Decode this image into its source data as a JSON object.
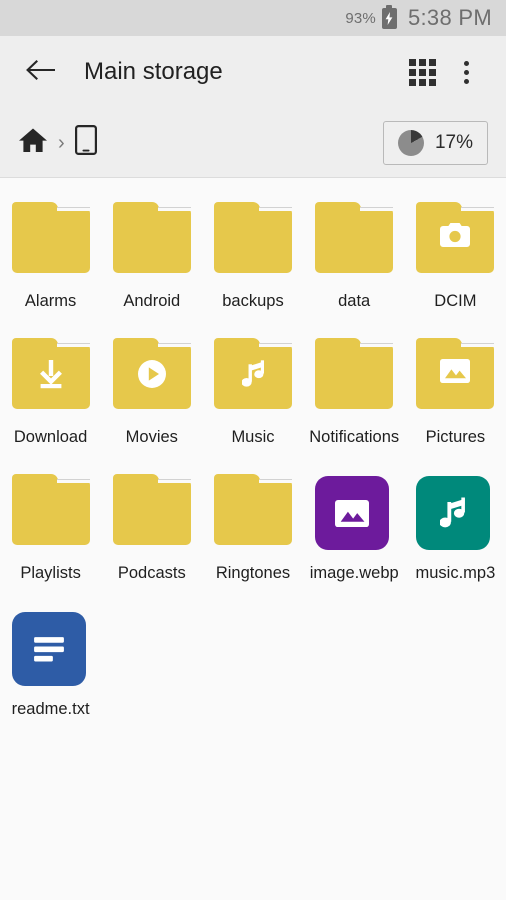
{
  "status_bar": {
    "battery_percent": "93%",
    "battery_icon": "battery-charging-icon",
    "time": "5:38 PM"
  },
  "app_bar": {
    "back_icon": "arrow-back-icon",
    "title": "Main storage",
    "view_toggle_icon": "grid-view-icon",
    "overflow_icon": "overflow-menu-icon"
  },
  "breadcrumb": {
    "items": [
      {
        "icon": "home-icon",
        "label": ""
      },
      {
        "icon": "phone-icon",
        "label": ""
      }
    ],
    "separator": "›",
    "storage": {
      "icon": "pie-chart-icon",
      "used_percent": "17%",
      "used_fraction": 0.17
    }
  },
  "files": [
    {
      "name": "Alarms",
      "type": "folder",
      "badge": "none"
    },
    {
      "name": "Android",
      "type": "folder",
      "badge": "none"
    },
    {
      "name": "backups",
      "type": "folder",
      "badge": "none"
    },
    {
      "name": "data",
      "type": "folder",
      "badge": "none"
    },
    {
      "name": "DCIM",
      "type": "folder",
      "badge": "camera-icon"
    },
    {
      "name": "Download",
      "type": "folder",
      "badge": "download-icon"
    },
    {
      "name": "Movies",
      "type": "folder",
      "badge": "play-circle-icon"
    },
    {
      "name": "Music",
      "type": "folder",
      "badge": "music-note-icon"
    },
    {
      "name": "Notifications",
      "type": "folder",
      "badge": "none"
    },
    {
      "name": "Pictures",
      "type": "folder",
      "badge": "image-icon"
    },
    {
      "name": "Playlists",
      "type": "folder",
      "badge": "none"
    },
    {
      "name": "Podcasts",
      "type": "folder",
      "badge": "none"
    },
    {
      "name": "Ringtones",
      "type": "folder",
      "badge": "none"
    },
    {
      "name": "image.webp",
      "type": "file",
      "badge": "image-icon",
      "tile_color": "#6D1B9C"
    },
    {
      "name": "music.mp3",
      "type": "file",
      "badge": "music-note-icon",
      "tile_color": "#00897B"
    },
    {
      "name": "readme.txt",
      "type": "file",
      "badge": "text-lines-icon",
      "tile_color": "#2E5CA6"
    }
  ],
  "colors": {
    "folder": "#E6C84B",
    "status_bar_bg": "#D8D8D8",
    "app_bar_bg": "#EEEEEE",
    "page_bg": "#FAFAFA",
    "text": "#1F1F1F"
  }
}
